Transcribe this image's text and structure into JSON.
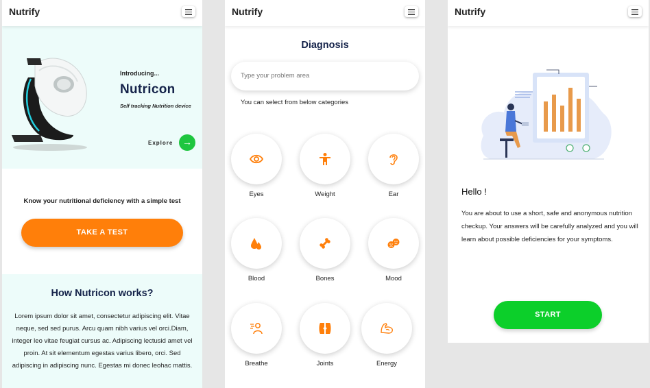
{
  "app": {
    "name": "Nutrify"
  },
  "home": {
    "hero": {
      "introducing": "Introducing...",
      "product": "Nutricon",
      "tagline": "Self tracking Nutrition device",
      "explore": "Explore",
      "explore_arrow": "→"
    },
    "know_text": "Know your nutritional deficiency with a simple test",
    "take_test": "TAKE A TEST",
    "how_title": "How Nutricon works?",
    "how_body": "Lorem ipsum dolor sit amet, consectetur adipiscing elit. Vitae neque, sed sed purus. Arcu quam nibh varius vel orci.Diam, integer leo vitae feugiat cursus ac. Adipiscing lectusid amet vel proin. At sit elementum egestas varius libero, orci. Sed adipiscing in adipiscing nunc. Egestas mi donec leohac mattis."
  },
  "diagnosis": {
    "title": "Diagnosis",
    "search_placeholder": "Type your problem area",
    "select_text": "You can select from below categories",
    "categories": [
      {
        "label": "Eyes",
        "icon": "eye-icon"
      },
      {
        "label": "Weight",
        "icon": "person-icon"
      },
      {
        "label": "Ear",
        "icon": "ear-icon"
      },
      {
        "label": "Blood",
        "icon": "blood-drop-icon"
      },
      {
        "label": "Bones",
        "icon": "bone-icon"
      },
      {
        "label": "Mood",
        "icon": "mood-icon"
      },
      {
        "label": "Breathe",
        "icon": "breathe-icon"
      },
      {
        "label": "Joints",
        "icon": "joints-icon"
      },
      {
        "label": "Energy",
        "icon": "energy-arm-icon"
      }
    ]
  },
  "welcome": {
    "hello": "Hello !",
    "body": "You are about to use a short, safe and anonymous nutrition checkup. Your answers will be carefully analyzed and you will learn about possible deficiencies for your symptoms.",
    "start": "START"
  },
  "colors": {
    "accent_orange": "#ff7f0a",
    "accent_green": "#0ccf2a",
    "navy": "#15234a",
    "mint_bg": "#edfcfa"
  }
}
